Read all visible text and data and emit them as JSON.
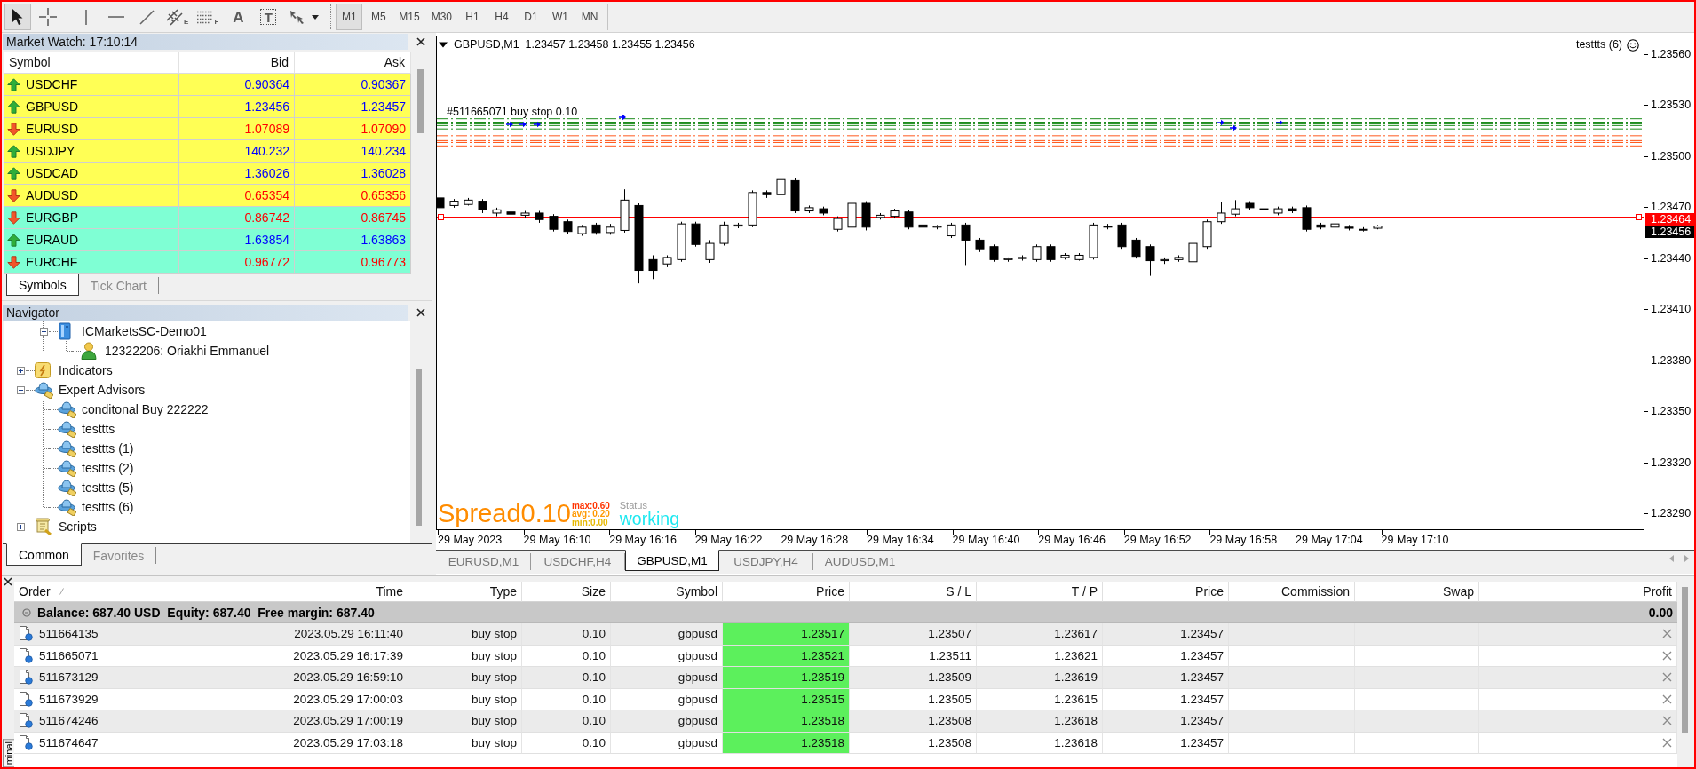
{
  "toolbar": {
    "drawing_tools": [
      {
        "kind": "cursor",
        "selected": true
      },
      {
        "kind": "crosshair",
        "selected": false
      },
      {
        "kind": "vline",
        "selected": false
      },
      {
        "kind": "hline",
        "selected": false
      },
      {
        "kind": "trendline",
        "selected": false
      },
      {
        "kind": "channel",
        "selected": false,
        "glyph": "E"
      },
      {
        "kind": "fibonacci",
        "selected": false,
        "glyph": "F"
      },
      {
        "kind": "text",
        "selected": false,
        "glyph": "A"
      },
      {
        "kind": "label",
        "selected": false,
        "glyph": "T"
      },
      {
        "kind": "arrows",
        "selected": false
      }
    ],
    "timeframes": [
      {
        "label": "M1",
        "selected": true
      },
      {
        "label": "M5",
        "selected": false
      },
      {
        "label": "M15",
        "selected": false
      },
      {
        "label": "M30",
        "selected": false
      },
      {
        "label": "H1",
        "selected": false
      },
      {
        "label": "H4",
        "selected": false
      },
      {
        "label": "D1",
        "selected": false
      },
      {
        "label": "W1",
        "selected": false
      },
      {
        "label": "MN",
        "selected": false
      }
    ]
  },
  "market_watch": {
    "title": "Market Watch: 17:10:14",
    "columns": [
      "Symbol",
      "Bid",
      "Ask"
    ],
    "rows": [
      {
        "symbol": "USDCHF",
        "bid": "0.90364",
        "ask": "0.90367",
        "rising": true,
        "color": "#ffff55"
      },
      {
        "symbol": "GBPUSD",
        "bid": "1.23456",
        "ask": "1.23457",
        "rising": true,
        "color": "#ffff55"
      },
      {
        "symbol": "EURUSD",
        "bid": "1.07089",
        "ask": "1.07090",
        "rising": false,
        "color": "#ffff55"
      },
      {
        "symbol": "USDJPY",
        "bid": "140.232",
        "ask": "140.234",
        "rising": true,
        "color": "#ffff55"
      },
      {
        "symbol": "USDCAD",
        "bid": "1.36026",
        "ask": "1.36028",
        "rising": true,
        "color": "#ffff55"
      },
      {
        "symbol": "AUDUSD",
        "bid": "0.65354",
        "ask": "0.65356",
        "rising": false,
        "color": "#ffff55"
      },
      {
        "symbol": "EURGBP",
        "bid": "0.86742",
        "ask": "0.86745",
        "rising": false,
        "color": "#7fffd4"
      },
      {
        "symbol": "EURAUD",
        "bid": "1.63854",
        "ask": "1.63863",
        "rising": true,
        "color": "#7fffd4"
      },
      {
        "symbol": "EURCHF",
        "bid": "0.96772",
        "ask": "0.96773",
        "rising": false,
        "color": "#7fffd4"
      }
    ],
    "tabs": [
      {
        "label": "Symbols",
        "selected": true
      },
      {
        "label": "Tick Chart",
        "selected": false
      }
    ]
  },
  "navigator": {
    "title": "Navigator",
    "tree": [
      {
        "kind": "scrolled",
        "children": [
          {
            "kind": "broker",
            "label": "ICMarketsSC-Demo01",
            "expanded": true,
            "children": [
              {
                "kind": "account",
                "label": "12322206: Oriakhi Emmanuel"
              }
            ]
          }
        ]
      },
      {
        "kind": "indicators",
        "label": "Indicators",
        "expanded": false
      },
      {
        "kind": "experts",
        "label": "Expert Advisors",
        "expanded": true,
        "children": [
          {
            "kind": "expert",
            "label": "conditonal Buy 222222"
          },
          {
            "kind": "expert",
            "label": "testtts"
          },
          {
            "kind": "expert",
            "label": "testtts (1)"
          },
          {
            "kind": "expert",
            "label": "testtts (2)"
          },
          {
            "kind": "expert",
            "label": "testtts (5)"
          },
          {
            "kind": "expert",
            "label": "testtts (6)"
          }
        ]
      },
      {
        "kind": "scripts",
        "label": "Scripts",
        "expanded": false
      }
    ],
    "tabs": [
      {
        "label": "Common",
        "selected": true
      },
      {
        "label": "Favorites",
        "selected": false
      }
    ]
  },
  "chart": {
    "header": "GBPUSD,M1  1.23457 1.23458 1.23455 1.23456",
    "expert": "testtts (6)",
    "order_label": "#511665071 buy stop 0.10",
    "spread": {
      "value": "Spread0.10",
      "stats": [
        {
          "text": "max:0.60",
          "color": "#ff3300"
        },
        {
          "text": "avg: 0.20",
          "color": "#ff9900"
        },
        {
          "text": "min:0.00",
          "color": "#e6b800"
        }
      ],
      "status_label": "Status",
      "status": "working"
    },
    "price_scale": [
      "1.23560",
      "1.23530",
      "1.23500",
      "1.23470",
      "1.23440",
      "1.23410",
      "1.23380",
      "1.23350",
      "1.23320",
      "1.23290"
    ],
    "price_tags": [
      {
        "text": "1.23464",
        "color": "#ff0000"
      },
      {
        "text": "1.23456",
        "color": "#000000"
      }
    ],
    "time_scale": [
      "29 May 2023",
      "29 May 16:10",
      "29 May 16:16",
      "29 May 16:22",
      "29 May 16:28",
      "29 May 16:34",
      "29 May 16:40",
      "29 May 16:46",
      "29 May 16:52",
      "29 May 16:58",
      "29 May 17:04",
      "29 May 17:10"
    ],
    "tabs": [
      {
        "label": "EURUSD,M1",
        "selected": false
      },
      {
        "label": "USDCHF,H4",
        "selected": false
      },
      {
        "label": "GBPUSD,M1",
        "selected": true
      },
      {
        "label": "USDJPY,H4",
        "selected": false
      },
      {
        "label": "AUDUSD,M1",
        "selected": false
      }
    ]
  },
  "terminal": {
    "side_label": "minal",
    "columns": [
      "Order",
      "Time",
      "Type",
      "Size",
      "Symbol",
      "Price",
      "S / L",
      "T / P",
      "Price",
      "Commission",
      "Swap",
      "Profit"
    ],
    "balance": {
      "summary": "Balance: 687.40 USD  Equity: 687.40  Free margin: 687.40",
      "profit": "0.00"
    },
    "rows": [
      {
        "order": "511664135",
        "time": "2023.05.29 16:11:40",
        "type": "buy stop",
        "size": "0.10",
        "symbol": "gbpusd",
        "price": "1.23517",
        "sl": "1.23507",
        "tp": "1.23617",
        "market_price": "1.23457"
      },
      {
        "order": "511665071",
        "time": "2023.05.29 16:17:39",
        "type": "buy stop",
        "size": "0.10",
        "symbol": "gbpusd",
        "price": "1.23521",
        "sl": "1.23511",
        "tp": "1.23621",
        "market_price": "1.23457"
      },
      {
        "order": "511673129",
        "time": "2023.05.29 16:59:10",
        "type": "buy stop",
        "size": "0.10",
        "symbol": "gbpusd",
        "price": "1.23519",
        "sl": "1.23509",
        "tp": "1.23619",
        "market_price": "1.23457"
      },
      {
        "order": "511673929",
        "time": "2023.05.29 17:00:03",
        "type": "buy stop",
        "size": "0.10",
        "symbol": "gbpusd",
        "price": "1.23515",
        "sl": "1.23505",
        "tp": "1.23615",
        "market_price": "1.23457"
      },
      {
        "order": "511674246",
        "time": "2023.05.29 17:00:19",
        "type": "buy stop",
        "size": "0.10",
        "symbol": "gbpusd",
        "price": "1.23518",
        "sl": "1.23508",
        "tp": "1.23618",
        "market_price": "1.23457"
      },
      {
        "order": "511674647",
        "time": "2023.05.29 17:03:18",
        "type": "buy stop",
        "size": "0.10",
        "symbol": "gbpusd",
        "price": "1.23518",
        "sl": "1.23508",
        "tp": "1.23618",
        "market_price": "1.23457"
      }
    ]
  }
}
